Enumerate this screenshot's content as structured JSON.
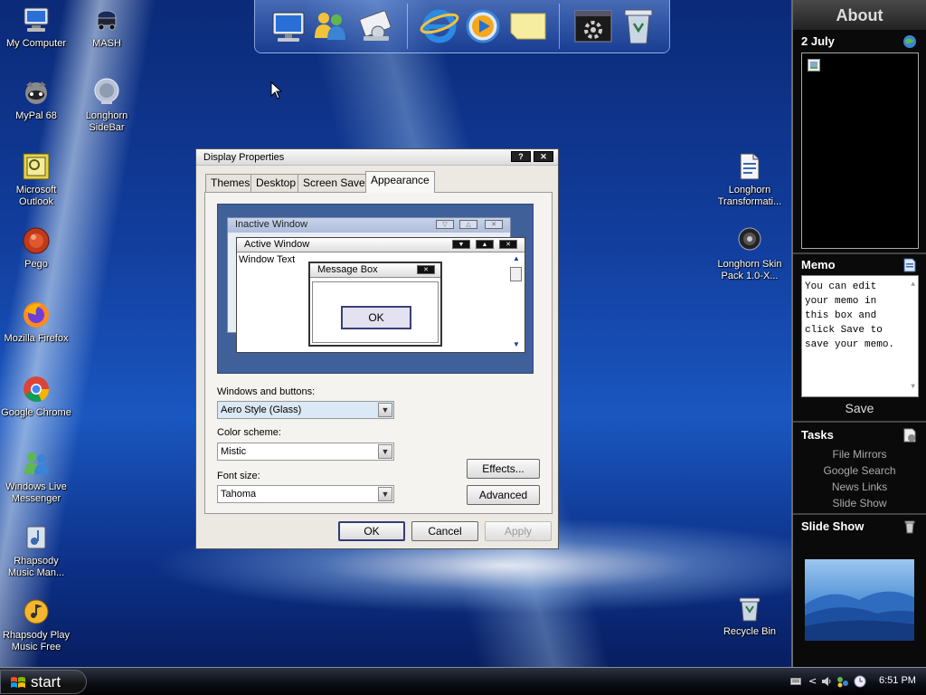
{
  "desktop_icons": [
    {
      "label": "My Computer",
      "icon": "computer-icon"
    },
    {
      "label": "MASH",
      "icon": "mash-icon"
    },
    {
      "label": "MyPal 68",
      "icon": "mypal-icon"
    },
    {
      "label": "Longhorn SideBar",
      "icon": "longhorn-sidebar-icon"
    },
    {
      "label": "Microsoft Outlook",
      "icon": "outlook-icon"
    },
    {
      "label": "Pego",
      "icon": "pego-icon"
    },
    {
      "label": "Mozilla Firefox",
      "icon": "firefox-icon"
    },
    {
      "label": "Google Chrome",
      "icon": "chrome-icon"
    },
    {
      "label": "Windows Live Messenger",
      "icon": "messenger-icon"
    },
    {
      "label": "Rhapsody Music Man...",
      "icon": "rhapsody-icon"
    },
    {
      "label": "Rhapsody Play Music Free",
      "icon": "rhapsody-play-icon"
    },
    {
      "label": "Longhorn Transformati...",
      "icon": "document-icon"
    },
    {
      "label": "Longhorn Skin Pack 1.0-X...",
      "icon": "skinpack-icon"
    },
    {
      "label": "Recycle Bin",
      "icon": "recycle-bin-icon"
    }
  ],
  "dock": {
    "items": [
      "computer-icon",
      "users-icon",
      "network-icon",
      "internet-explorer-icon",
      "media-player-icon",
      "sticky-note-icon",
      "settings-window-icon",
      "recycle-bin-icon"
    ]
  },
  "sidebar": {
    "title": "About",
    "calendar": {
      "date": "2 July"
    },
    "memo": {
      "title": "Memo",
      "text": "You can edit your memo in this box and click Save to save your memo.",
      "save_label": "Save"
    },
    "tasks": {
      "title": "Tasks",
      "items": [
        "File Mirrors",
        "Google Search",
        "News Links",
        "Slide Show"
      ]
    },
    "slideshow": {
      "title": "Slide Show"
    }
  },
  "dialog": {
    "title": "Display Properties",
    "tabs": [
      "Themes",
      "Desktop",
      "Screen Saver",
      "Appearance"
    ],
    "active_tab": "Appearance",
    "preview": {
      "inactive_title": "Inactive Window",
      "active_title": "Active Window",
      "window_text": "Window Text",
      "message_title": "Message Box",
      "message_ok": "OK"
    },
    "windows_buttons_label": "Windows and buttons:",
    "windows_buttons_value": "Aero Style (Glass)",
    "color_scheme_label": "Color scheme:",
    "color_scheme_value": "Mistic",
    "font_size_label": "Font size:",
    "font_size_value": "Tahoma",
    "effects_label": "Effects...",
    "advanced_label": "Advanced",
    "ok_label": "OK",
    "cancel_label": "Cancel",
    "apply_label": "Apply"
  },
  "taskbar": {
    "start_label": "start",
    "clock": "6:51 PM",
    "tray_icons": [
      "keyboard-icon",
      "chevron-left-icon",
      "speaker-icon",
      "network-tray-icon",
      "clock-tray-icon"
    ]
  },
  "colors": {
    "accent": "#1a57c0",
    "selection": "#dbe8f5",
    "sidebar_bg": "#0a0a0a"
  }
}
